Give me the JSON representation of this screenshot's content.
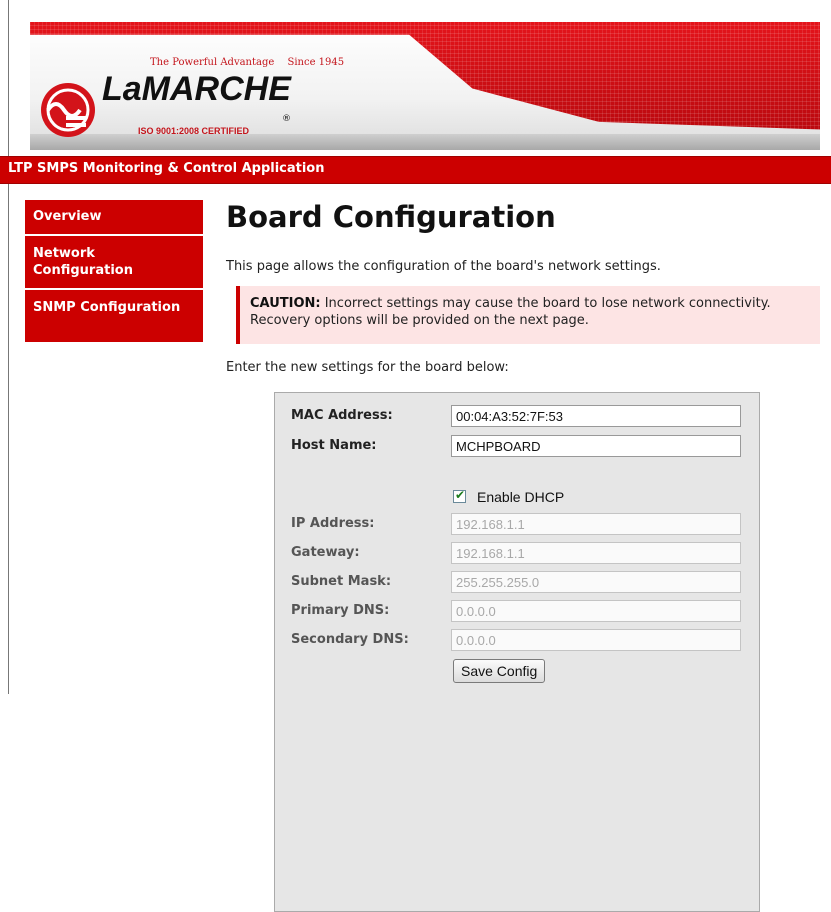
{
  "branding": {
    "tagline": "The Powerful Advantage",
    "since": "Since 1945",
    "logo_text": "LaMARCHE",
    "registered_mark": "®",
    "certification": "ISO 9001:2008 CERTIFIED",
    "colors": {
      "brand_red": "#cc0000",
      "caution_bg": "#fde4e4"
    }
  },
  "app": {
    "title": "LTP SMPS Monitoring & Control Application"
  },
  "sidebar": {
    "items": [
      {
        "label": "Overview"
      },
      {
        "label": "Network Configuration"
      },
      {
        "label": "SNMP Configuration"
      }
    ]
  },
  "main": {
    "title": "Board Configuration",
    "intro": "This page allows the configuration of the board's network settings.",
    "caution": {
      "label": "CAUTION:",
      "text": " Incorrect settings may cause the board to lose network connectivity. Recovery options will be provided on the next page."
    },
    "enter_text": "Enter the new settings for the board below:"
  },
  "form": {
    "mac_label": "MAC Address:",
    "mac_value": "00:04:A3:52:7F:53",
    "host_label": "Host Name:",
    "host_value": "MCHPBOARD",
    "dhcp_label": "Enable DHCP",
    "dhcp_checked": true,
    "ip_label": "IP Address:",
    "ip_value": "192.168.1.1",
    "gateway_label": "Gateway:",
    "gateway_value": "192.168.1.1",
    "subnet_label": "Subnet Mask:",
    "subnet_value": "255.255.255.0",
    "pdns_label": "Primary DNS:",
    "pdns_value": "0.0.0.0",
    "sdns_label": "Secondary DNS:",
    "sdns_value": "0.0.0.0",
    "save_label": "Save Config"
  }
}
